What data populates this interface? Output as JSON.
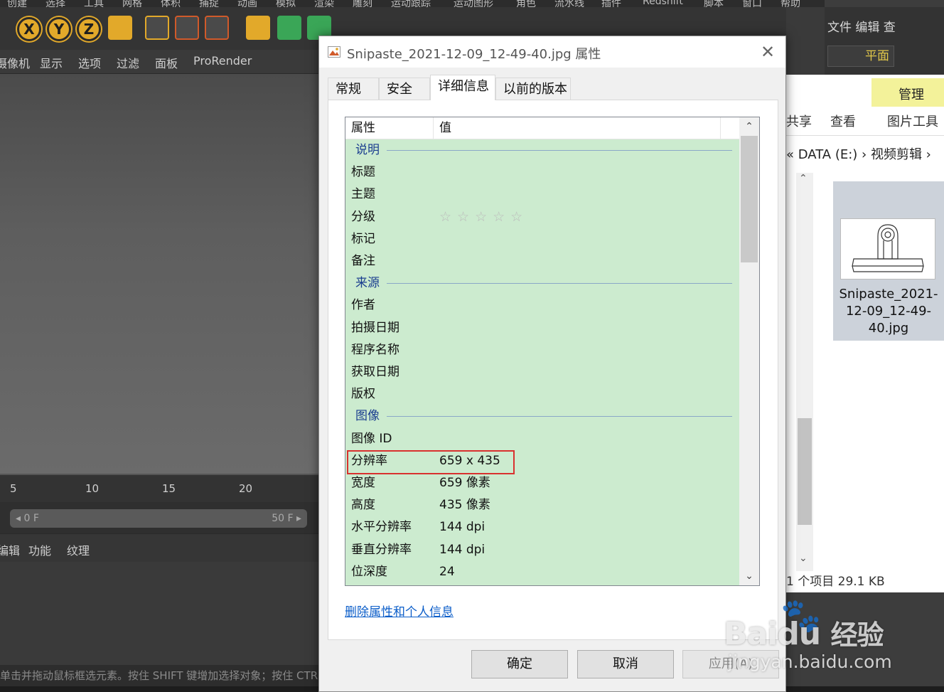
{
  "c4d": {
    "menubar": [
      "创建",
      "选择",
      "工具",
      "网格",
      "体积",
      "捕捉",
      "动画",
      "模拟",
      "渲染",
      "雕刻",
      "运动跟踪",
      "运动图形",
      "角色",
      "流水线",
      "插件",
      "Redshift",
      "脚本",
      "窗口",
      "帮助"
    ],
    "axis_buttons": [
      "X",
      "Y",
      "Z"
    ],
    "view_menu": [
      "摄像机",
      "显示",
      "选项",
      "过滤",
      "面板",
      "ProRender"
    ],
    "ruler_ticks": [
      "5",
      "10",
      "15",
      "20"
    ],
    "frame_start": "◂ 0 F",
    "frame_end": "50 F ▸",
    "bottom_menu": [
      "编辑",
      "功能",
      "纹理"
    ],
    "status_text": "单击并拖动鼠标框选元素。按住 SHIFT 键增加选择对象；按住 CTRL",
    "layout_row1": "文件   编辑   查",
    "layout_mode": "平面"
  },
  "explorer": {
    "ribbon_tab": "管理",
    "share": "共享",
    "view": "查看",
    "picture_tools": "图片工具",
    "address": "« DATA (E:)  ›  视频剪辑  ›",
    "file_name": "Snipaste_2021-12-09_12-49-40.jpg",
    "status": "1 个项目   29.1 KB"
  },
  "dialog": {
    "title": "Snipaste_2021-12-09_12-49-40.jpg 属性",
    "close_glyph": "✕",
    "tabs": [
      "常规",
      "安全",
      "详细信息",
      "以前的版本"
    ],
    "active_tab": "详细信息",
    "columns": {
      "property": "属性",
      "value": "值"
    },
    "rows": [
      {
        "type": "section",
        "label": "说明"
      },
      {
        "type": "row",
        "label": "标题",
        "value": ""
      },
      {
        "type": "row",
        "label": "主题",
        "value": ""
      },
      {
        "type": "rating",
        "label": "分级",
        "value": "☆☆☆☆☆",
        "stars_filled": 0,
        "stars_total": 5
      },
      {
        "type": "row",
        "label": "标记",
        "value": ""
      },
      {
        "type": "row",
        "label": "备注",
        "value": ""
      },
      {
        "type": "section",
        "label": "来源"
      },
      {
        "type": "row",
        "label": "作者",
        "value": ""
      },
      {
        "type": "row",
        "label": "拍摄日期",
        "value": ""
      },
      {
        "type": "row",
        "label": "程序名称",
        "value": ""
      },
      {
        "type": "row",
        "label": "获取日期",
        "value": ""
      },
      {
        "type": "row",
        "label": "版权",
        "value": ""
      },
      {
        "type": "section",
        "label": "图像"
      },
      {
        "type": "row",
        "label": "图像 ID",
        "value": ""
      },
      {
        "type": "row",
        "label": "分辨率",
        "value": "659 x 435",
        "highlighted": true
      },
      {
        "type": "row",
        "label": "宽度",
        "value": "659 像素"
      },
      {
        "type": "row",
        "label": "高度",
        "value": "435 像素"
      },
      {
        "type": "row",
        "label": "水平分辨率",
        "value": "144 dpi"
      },
      {
        "type": "row",
        "label": "垂直分辨率",
        "value": "144 dpi"
      },
      {
        "type": "row",
        "label": "位深度",
        "value": "24"
      }
    ],
    "remove_link": "删除属性和个人信息",
    "buttons": {
      "ok": "确定",
      "cancel": "取消",
      "apply": "应用(A)"
    },
    "colors": {
      "grid_background": "#ccebcf",
      "highlight_border": "#d9312f",
      "section_text": "#1a3d8f",
      "link": "#0c5ec9"
    }
  },
  "watermark": {
    "brand": "Bai",
    "brand2": "du",
    "jingyan": "经验",
    "url": "jingyan.baidu.com"
  }
}
